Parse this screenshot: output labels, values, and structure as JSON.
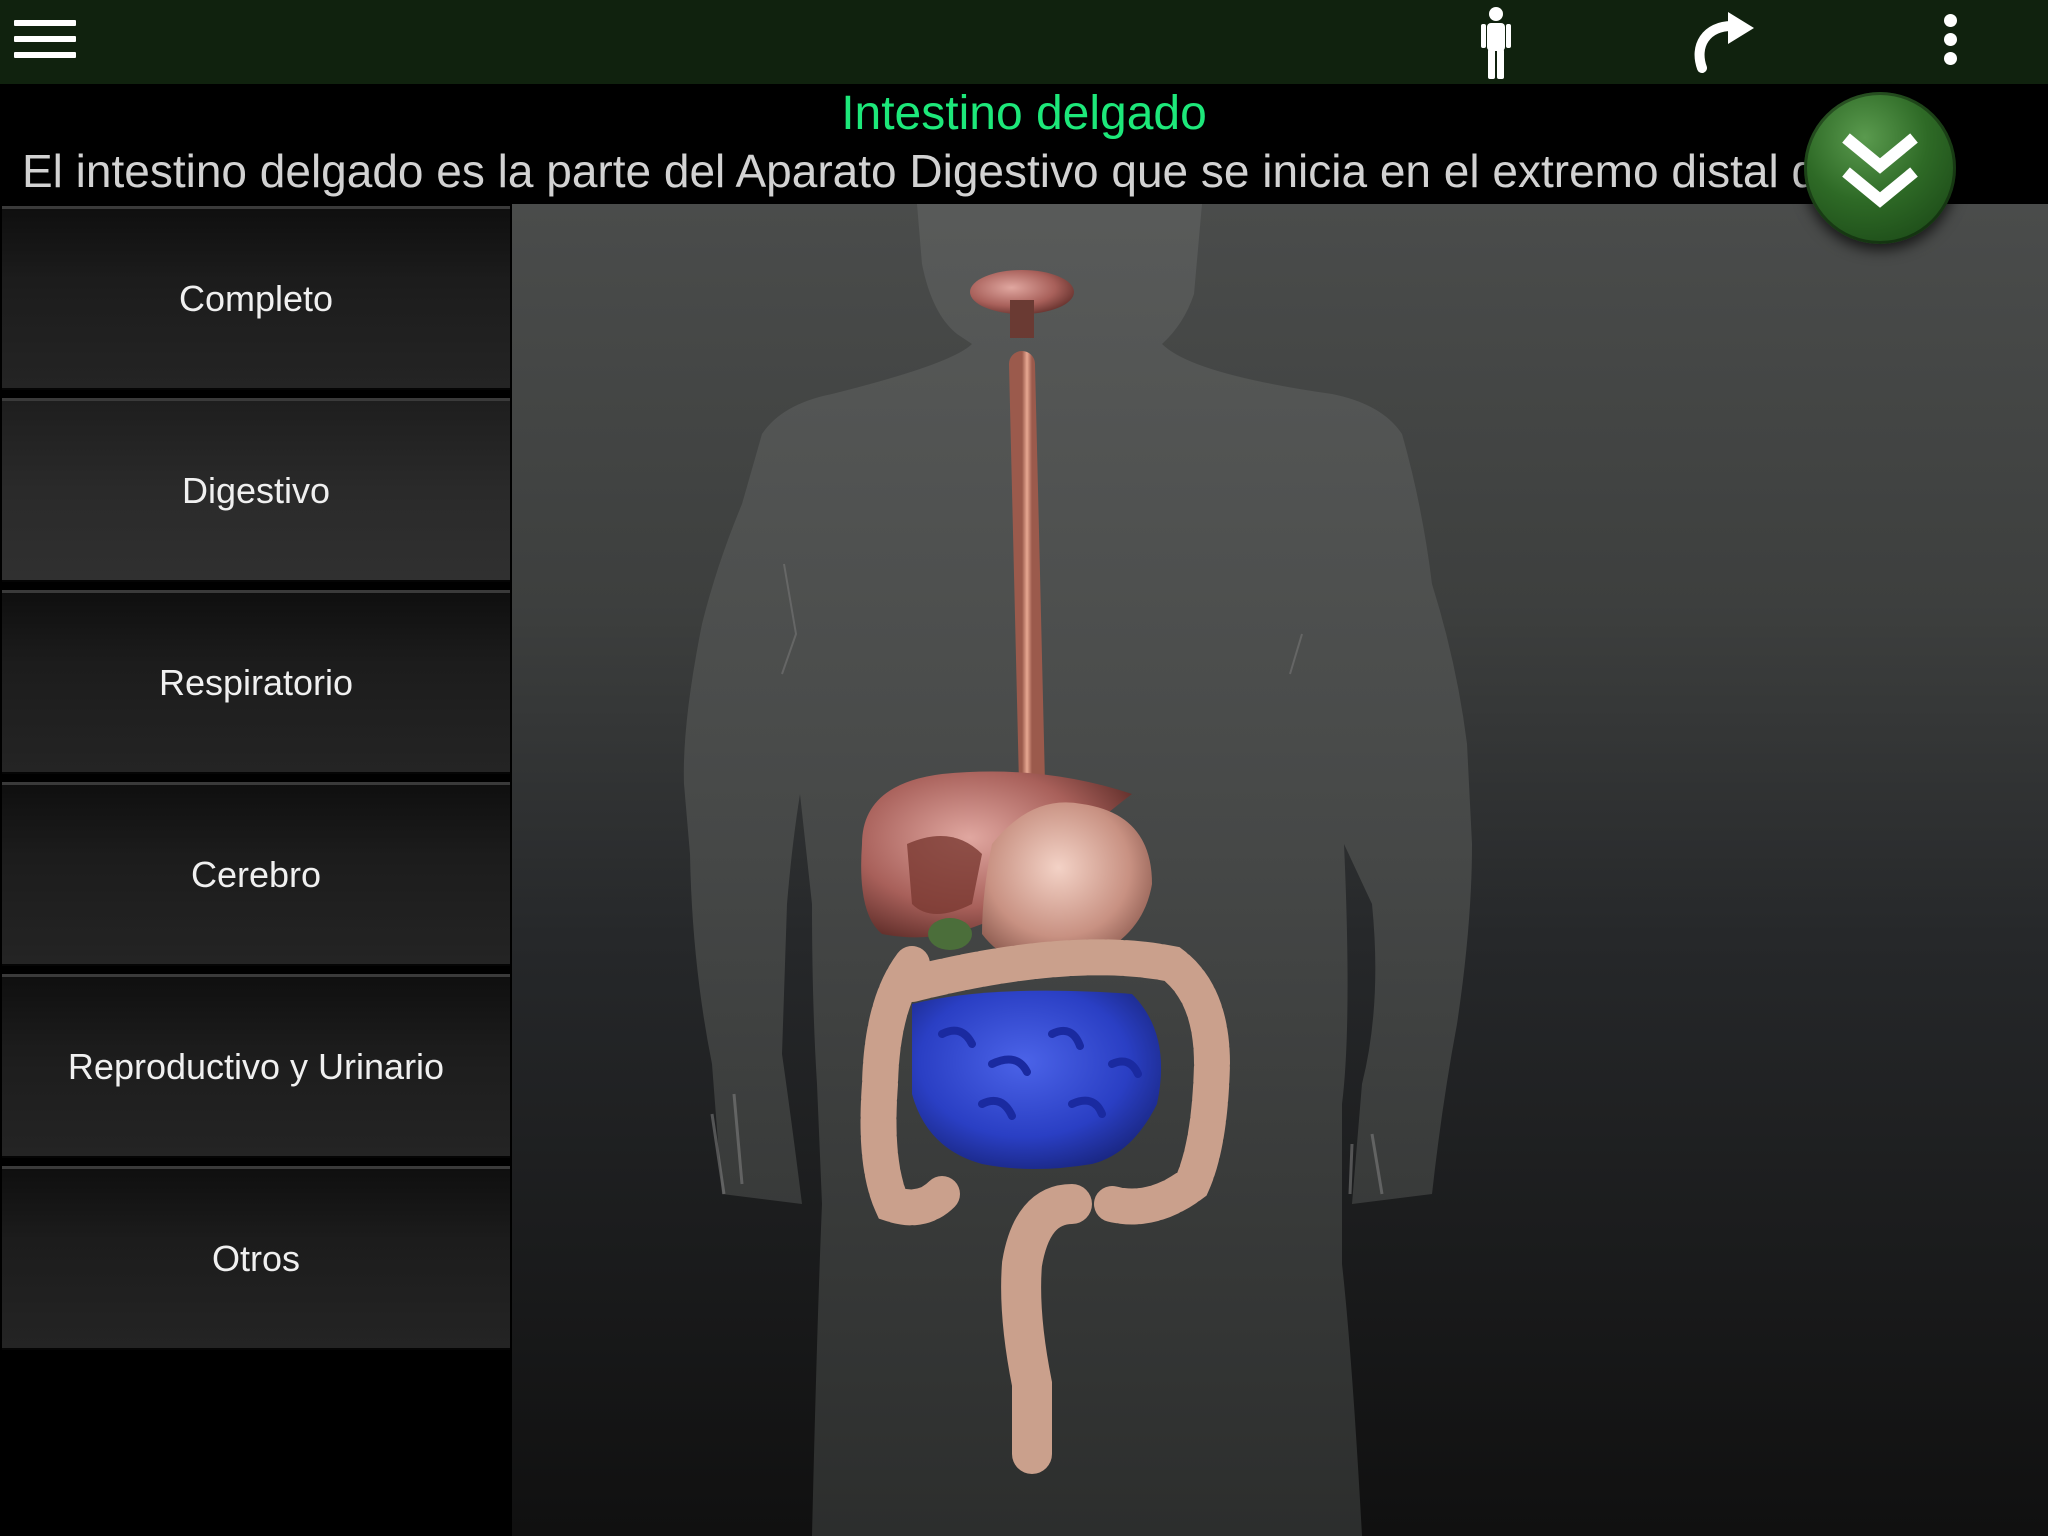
{
  "app": {
    "menu_icon": "hamburger-menu-icon",
    "body_icon": "human-figure-icon",
    "redo_icon": "redo-arrow-icon",
    "more_icon": "more-vertical-icon"
  },
  "header": {
    "title": "Intestino delgado",
    "description": "El intestino delgado es la parte del Aparato Digestivo que se inicia en el extremo distal del",
    "expand_icon": "double-chevron-down-icon"
  },
  "sidebar": {
    "items": [
      {
        "label": "Completo"
      },
      {
        "label": "Digestivo"
      },
      {
        "label": "Respiratorio"
      },
      {
        "label": "Cerebro"
      },
      {
        "label": "Reproductivo y Urinario"
      },
      {
        "label": "Otros"
      }
    ],
    "selected": "Digestivo"
  },
  "colors": {
    "toolbar": "#10220e",
    "title_text": "#1de87a",
    "highlight_organ": "#2a3fc4",
    "expand_button": "#2e6a26"
  }
}
